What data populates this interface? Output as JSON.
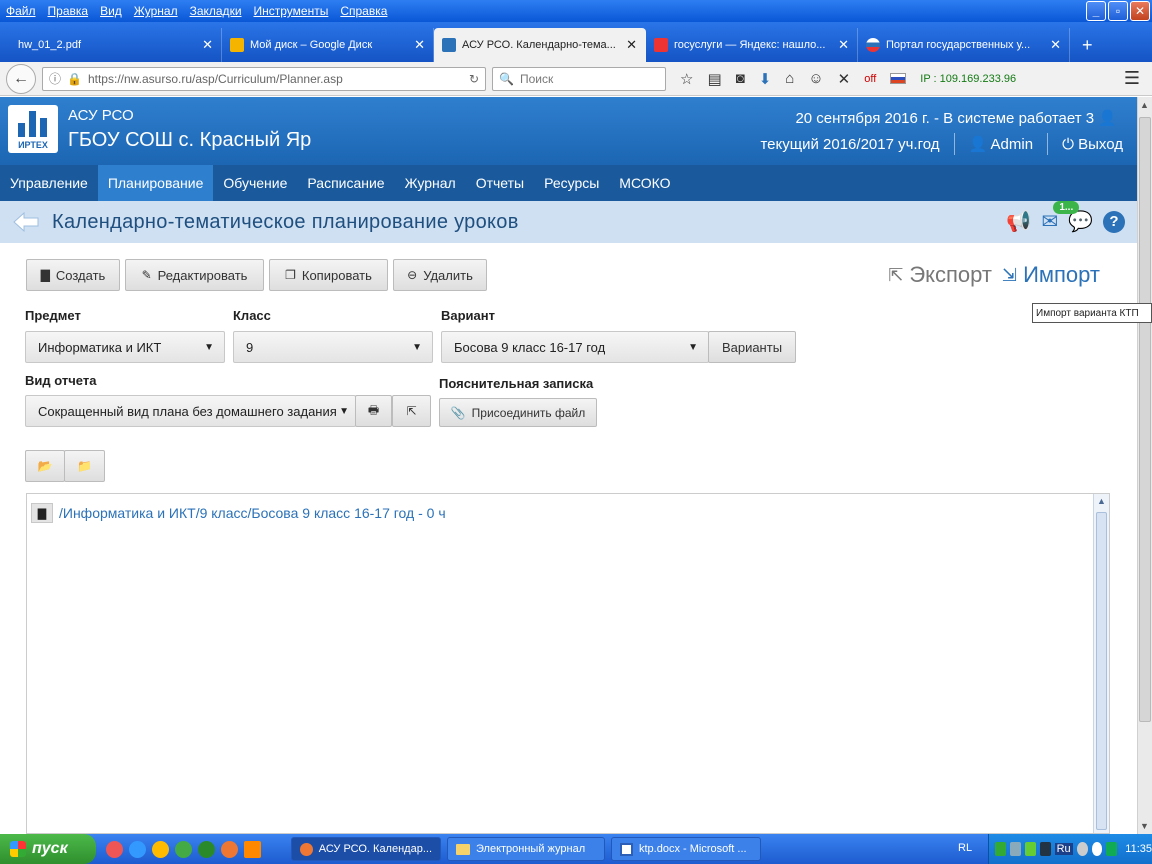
{
  "browser": {
    "menu": [
      "Файл",
      "Правка",
      "Вид",
      "Журнал",
      "Закладки",
      "Инструменты",
      "Справка"
    ],
    "window_buttons": {
      "minimize": "_",
      "maximize": "▫",
      "close": "✕"
    },
    "tabs": [
      {
        "title": "hw_01_2.pdf",
        "active": false,
        "favicon_color": "#c33"
      },
      {
        "title": "Мой диск – Google Диск",
        "active": false,
        "favicon_color": "#f4b400"
      },
      {
        "title": "АСУ РСО. Календарно-тема...",
        "active": true,
        "favicon_color": "#2b72b8"
      },
      {
        "title": "госуслуги — Яндекс: нашло...",
        "active": false,
        "favicon_color": "#e33"
      },
      {
        "title": "Портал государственных у...",
        "active": false,
        "favicon_color": "#2b72b8"
      }
    ],
    "close_glyph": "✕",
    "newtab_glyph": "+",
    "url": "https://nw.asurso.ru/asp/Curriculum/Planner.asp",
    "search_placeholder": "Поиск",
    "off_label": "off",
    "ip_label": "IP : 109.169.233.96"
  },
  "app": {
    "logo_text": "ИРТЕХ",
    "app_name": "АСУ РСО",
    "school_name": "ГБОУ СОШ с. Красный Яр",
    "date_line": "20 сентября 2016 г. - В системе работает 3",
    "year_line": "текущий 2016/2017 уч.год",
    "user": "Admin",
    "logout": "Выход"
  },
  "nav": {
    "items": [
      {
        "label": "Управление",
        "active": false
      },
      {
        "label": "Планирование",
        "active": true
      },
      {
        "label": "Обучение",
        "active": false
      },
      {
        "label": "Расписание",
        "active": false
      },
      {
        "label": "Журнал",
        "active": false
      },
      {
        "label": "Отчеты",
        "active": false
      },
      {
        "label": "Ресурсы",
        "active": false
      },
      {
        "label": "МСОКО",
        "active": false
      }
    ]
  },
  "page": {
    "title": "Календарно-тематическое планирование уроков",
    "mail_badge": "1..."
  },
  "toolbar": {
    "create": "Создать",
    "edit": "Редактировать",
    "copy": "Копировать",
    "delete": "Удалить",
    "export": "Экспорт",
    "import": "Импорт",
    "import_tooltip": "Импорт варианта КТП"
  },
  "filters": {
    "subject_label": "Предмет",
    "subject_value": "Информатика и ИКТ",
    "class_label": "Класс",
    "class_value": "9",
    "variant_label": "Вариант",
    "variant_value": "Босова 9 класс 16-17 год",
    "variants_button": "Варианты",
    "report_label": "Вид отчета",
    "report_value": "Сокращенный вид плана без домашнего задания",
    "note_label": "Пояснительная записка",
    "attach_button": "Присоединить файл"
  },
  "tree": {
    "root_path": "/Информатика и ИКТ/9 класс/Босова 9 класс 16-17 год - 0 ч"
  },
  "taskbar": {
    "start": "пуск",
    "tasks": [
      {
        "label": "АСУ РСО. Календар...",
        "active": true
      },
      {
        "label": "Электронный журнал",
        "active": false
      },
      {
        "label": "ktp.docx - Microsoft ...",
        "active": false
      }
    ],
    "lang": "RL",
    "tray_lang": "Ru",
    "clock": "11:35"
  },
  "colors": {
    "accent": "#1f6fbf",
    "nav_bg": "#1a5a9c",
    "title_bg": "#cfe0f2",
    "link": "#2b72b8"
  }
}
